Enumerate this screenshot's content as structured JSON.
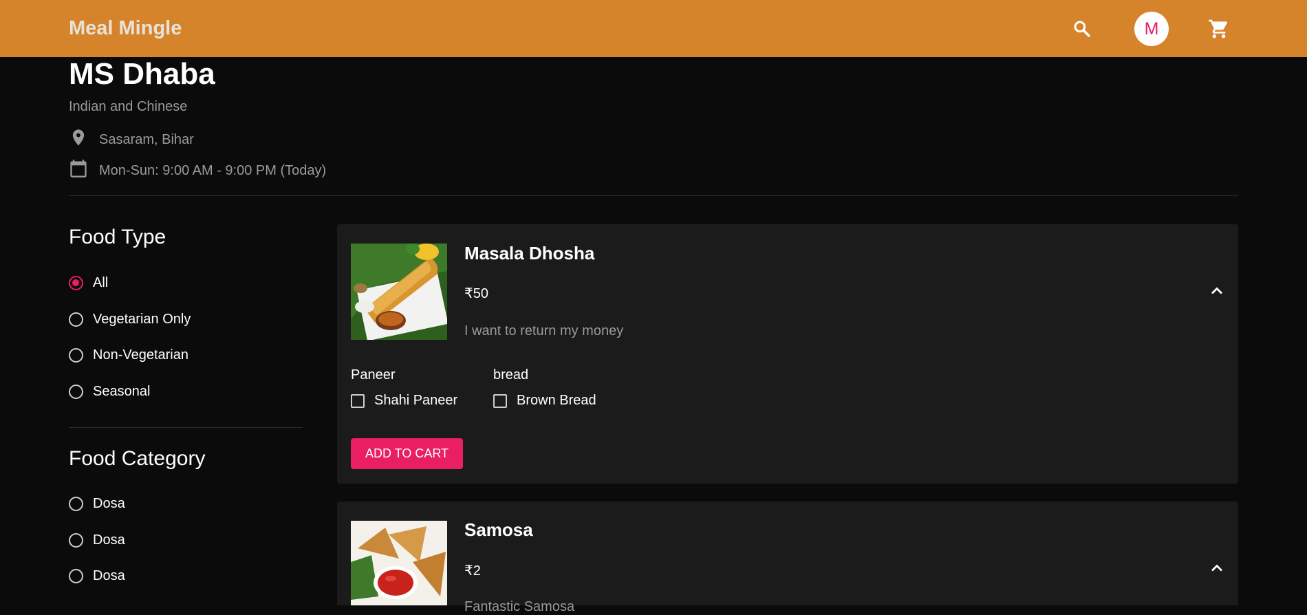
{
  "header": {
    "brand": "Meal Mingle",
    "avatar_letter": "M",
    "search_icon": "search-icon",
    "cart_icon": "cart-icon"
  },
  "restaurant": {
    "name": "MS Dhaba",
    "cuisine": "Indian and Chinese",
    "location": "Sasaram, Bihar",
    "hours": "Mon-Sun: 9:00 AM - 9:00 PM (Today)"
  },
  "filters": {
    "food_type": {
      "title": "Food Type",
      "options": [
        "All",
        "Vegetarian Only",
        "Non-Vegetarian",
        "Seasonal"
      ],
      "selected": "All"
    },
    "food_category": {
      "title": "Food Category",
      "options": [
        "Dosa",
        "Dosa",
        "Dosa"
      ]
    }
  },
  "menu": [
    {
      "name": "Masala Dhosha",
      "price": "₹50",
      "description": "I want to return my money",
      "addons": [
        {
          "title": "Paneer",
          "option": "Shahi Paneer"
        },
        {
          "title": "bread",
          "option": "Brown Bread"
        }
      ],
      "add_label": "ADD TO CART"
    },
    {
      "name": "Samosa",
      "price": "₹2",
      "description": "Fantastic Samosa"
    }
  ],
  "colors": {
    "header": "#d6842c",
    "accent": "#e91e63",
    "background": "#0b0b0b",
    "card": "#1b1b1b"
  }
}
